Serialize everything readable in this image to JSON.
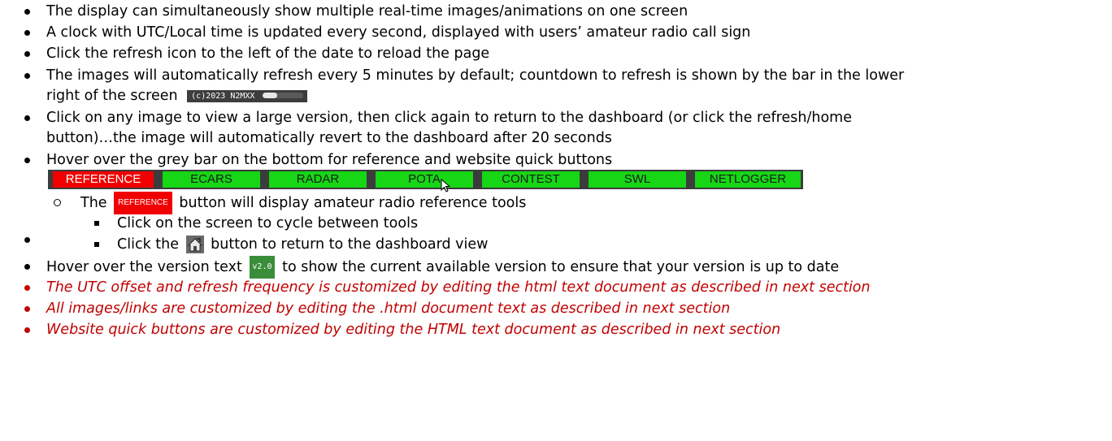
{
  "bullets": {
    "b1": "The display can simultaneously show multiple real-time images/animations on one screen",
    "b2": "A clock with UTC/Local time is updated every second, displayed with users’ amateur radio call sign",
    "b3": "Click the refresh icon to the left of the date to reload the page",
    "b4_line1": "The images will automatically refresh every 5 minutes by default; countdown to refresh is shown by the bar in the lower",
    "b4_line2": "right of the screen",
    "b5_line1": "Click on any image to view a large version, then click again to return to the dashboard (or click the refresh/home",
    "b5_line2": "button)…the image will automatically revert to the dashboard after 20 seconds",
    "b6": "Hover over the grey bar on the bottom for reference and website quick buttons",
    "sub_ref_pre": "The",
    "sub_ref_post": "button will display amateur radio reference tools",
    "sub_sub1": "Click on the screen to cycle between tools",
    "sub_sub2_pre": "Click the",
    "sub_sub2_post": "button to return to the dashboard view",
    "b7_pre": "Hover over the version text",
    "b7_post": "to show the current available version to ensure that your version is up to date",
    "red1": "The UTC offset and refresh frequency is customized by editing the html text document as described in next section",
    "red2": "All images/links are customized by editing the .html document text as described in next section",
    "red3": "Website quick buttons are customized by editing the HTML text document as described in next section"
  },
  "clock_bar": {
    "text": "(c)2023 N2MXX",
    "progress": 0.35
  },
  "quick_buttons": [
    "REFERENCE",
    "ECARS",
    "RADAR",
    "POTA",
    "CONTEST",
    "SWL",
    "NETLOGGER"
  ],
  "reference_inline": "REFERENCE",
  "version_badge": "v2.0",
  "colors": {
    "reference": "#f00000",
    "quick_green": "#16d616",
    "bar_bg": "#3c3c3c",
    "red_text": "#c00000"
  },
  "icons": {
    "home": "home-icon",
    "cursor": "mouse-cursor-icon"
  }
}
